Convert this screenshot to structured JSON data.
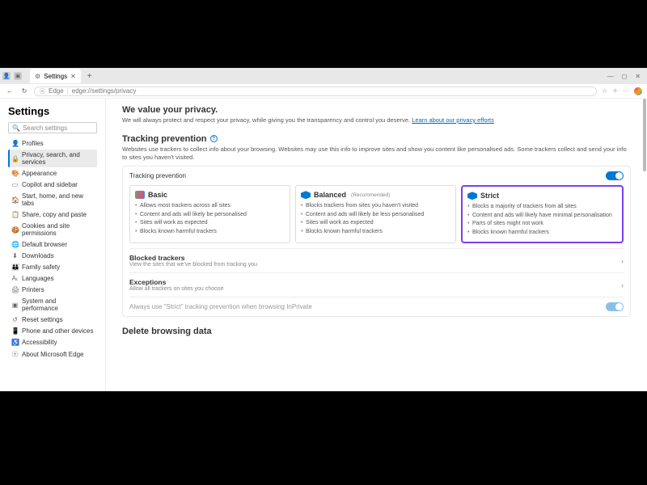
{
  "titlebar": {
    "tab_title": "Settings",
    "min": "—",
    "max": "◻",
    "close": "✕",
    "plus": "+"
  },
  "addressbar": {
    "back": "←",
    "refresh": "↻",
    "icon_label": "Edge",
    "url": "edge://settings/privacy",
    "star": "☆",
    "fav": "✧",
    "more": "···"
  },
  "sidebar": {
    "title": "Settings",
    "search_placeholder": "Search settings",
    "items": [
      {
        "icon": "👤",
        "label": "Profiles"
      },
      {
        "icon": "🔒",
        "label": "Privacy, search, and services"
      },
      {
        "icon": "🎨",
        "label": "Appearance"
      },
      {
        "icon": "▭",
        "label": "Copilot and sidebar"
      },
      {
        "icon": "🏠",
        "label": "Start, home, and new tabs"
      },
      {
        "icon": "📋",
        "label": "Share, copy and paste"
      },
      {
        "icon": "🍪",
        "label": "Cookies and site permissions"
      },
      {
        "icon": "🌐",
        "label": "Default browser"
      },
      {
        "icon": "⬇",
        "label": "Downloads"
      },
      {
        "icon": "👪",
        "label": "Family safety"
      },
      {
        "icon": "Aₜ",
        "label": "Languages"
      },
      {
        "icon": "🖨",
        "label": "Printers"
      },
      {
        "icon": "▣",
        "label": "System and performance"
      },
      {
        "icon": "↺",
        "label": "Reset settings"
      },
      {
        "icon": "📱",
        "label": "Phone and other devices"
      },
      {
        "icon": "♿",
        "label": "Accessibility"
      },
      {
        "icon": "ⓔ",
        "label": "About Microsoft Edge"
      }
    ]
  },
  "main": {
    "privacy_heading": "We value your privacy.",
    "privacy_text": "We will always protect and respect your privacy, while giving you the transparency and control you deserve. ",
    "privacy_link": "Learn about our privacy efforts",
    "tracking_heading": "Tracking prevention",
    "tracking_sub": "Websites use trackers to collect info about your browsing. Websites may use this info to improve sites and show you content like personalised ads. Some trackers collect and send your info to sites you haven't visited.",
    "panel_label": "Tracking prevention",
    "cards": {
      "basic": {
        "title": "Basic",
        "bullets": [
          "Allows most trackers across all sites",
          "Content and ads will likely be personalised",
          "Sites will work as expected",
          "Blocks known harmful trackers"
        ]
      },
      "balanced": {
        "title": "Balanced",
        "rec": "(Recommended)",
        "bullets": [
          "Blocks trackers from sites you haven't visited",
          "Content and ads will likely be less personalised",
          "Sites will work as expected",
          "Blocks known harmful trackers"
        ]
      },
      "strict": {
        "title": "Strict",
        "bullets": [
          "Blocks a majority of trackers from all sites",
          "Content and ads will likely have minimal personalisation",
          "Parts of sites might not work",
          "Blocks known harmful trackers"
        ]
      }
    },
    "blocked_title": "Blocked trackers",
    "blocked_sub": "View the sites that we've blocked from tracking you",
    "exceptions_title": "Exceptions",
    "exceptions_sub": "Allow all trackers on sites you choose",
    "always_strict": "Always use \"Strict\" tracking prevention when browsing InPrivate",
    "delete_heading": "Delete browsing data"
  }
}
